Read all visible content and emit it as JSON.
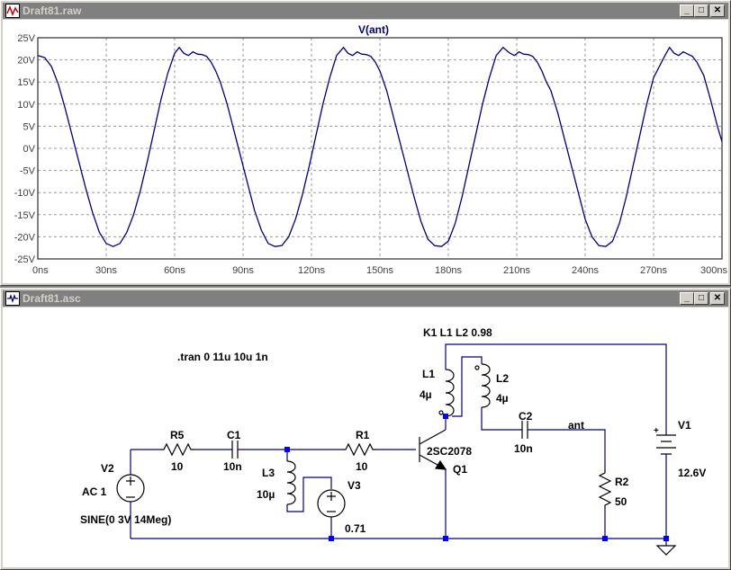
{
  "plot_window": {
    "title": "Draft81.raw",
    "trace_label": "V(ant)"
  },
  "chart_data": {
    "type": "line",
    "title": "V(ant)",
    "xlabel": "",
    "ylabel": "",
    "x_ticks": [
      "0ns",
      "30ns",
      "60ns",
      "90ns",
      "120ns",
      "150ns",
      "180ns",
      "210ns",
      "240ns",
      "270ns",
      "300ns"
    ],
    "y_ticks": [
      "25V",
      "20V",
      "15V",
      "10V",
      "5V",
      "0V",
      "-5V",
      "-10V",
      "-15V",
      "-20V",
      "-25V"
    ],
    "xlim": [
      0,
      300
    ],
    "ylim": [
      -25,
      25
    ],
    "grid": true,
    "x_unit": "ns",
    "y_unit": "V",
    "series": [
      {
        "name": "V(ant)",
        "color": "#000080",
        "x": [
          0,
          3,
          6,
          9,
          12,
          15,
          18,
          21,
          24,
          27,
          30,
          33,
          36,
          39,
          42,
          45,
          48,
          51,
          54,
          57,
          60,
          62,
          64,
          66,
          68,
          70,
          72,
          74,
          76,
          78,
          80,
          83,
          86,
          89,
          92,
          95,
          98,
          101,
          104,
          107,
          110,
          113,
          116,
          119,
          122,
          125,
          128,
          131,
          134,
          136,
          138,
          140,
          142,
          144,
          146,
          148,
          150,
          153,
          156,
          159,
          162,
          165,
          168,
          171,
          174,
          177,
          180,
          183,
          186,
          189,
          192,
          195,
          198,
          201,
          204,
          207,
          209,
          211,
          213,
          215,
          217,
          219,
          221,
          223,
          225,
          228,
          231,
          234,
          237,
          240,
          243,
          246,
          249,
          252,
          255,
          258,
          261,
          264,
          267,
          270,
          275,
          277,
          279,
          281,
          283,
          285,
          287,
          289,
          292,
          295,
          298,
          300
        ],
        "y": [
          21,
          20.5,
          18.5,
          14.5,
          9,
          3,
          -3,
          -9,
          -14.5,
          -19,
          -21.5,
          -22.2,
          -21.5,
          -19,
          -15,
          -9.5,
          -3,
          4,
          11,
          17,
          21.5,
          22.8,
          21.5,
          21,
          21.8,
          21.3,
          21.2,
          20.8,
          19.5,
          17.5,
          15,
          10,
          4,
          -2,
          -8,
          -14,
          -18.5,
          -21.5,
          -22.2,
          -22,
          -20,
          -16,
          -10.5,
          -4,
          3,
          10,
          16,
          21,
          22.8,
          21.5,
          21,
          21.8,
          21.3,
          21.2,
          20.8,
          19.5,
          17.5,
          13,
          7,
          1,
          -5,
          -11,
          -16.5,
          -20.5,
          -22,
          -22.2,
          -21,
          -17,
          -11,
          -4,
          3,
          10,
          16,
          21,
          22.8,
          21.5,
          21,
          21.8,
          21.3,
          21.2,
          20.8,
          19.5,
          17.5,
          15,
          13,
          8,
          2,
          -4,
          -10,
          -16,
          -20,
          -22,
          -22.2,
          -21,
          -17,
          -11,
          -4,
          3,
          10,
          16,
          21,
          22.8,
          21.5,
          21,
          21.8,
          21.3,
          20.8,
          19.5,
          16.5,
          11,
          5,
          1.5
        ]
      }
    ]
  },
  "schematic_window": {
    "title": "Draft81.asc"
  },
  "schematic": {
    "spice_directive": ".tran 0 11u 10u 1n",
    "coupling": "K1 L1 L2 0.98",
    "net_label_ant": "ant",
    "components": {
      "V2": {
        "ref": "V2",
        "value": "AC 1",
        "extra": "SINE(0 3V 14Meg)"
      },
      "R5": {
        "ref": "R5",
        "value": "10"
      },
      "C1": {
        "ref": "C1",
        "value": "10n"
      },
      "L3": {
        "ref": "L3",
        "value": "10µ"
      },
      "V3": {
        "ref": "V3",
        "value": "0.71"
      },
      "R1": {
        "ref": "R1",
        "value": "10"
      },
      "Q1": {
        "ref": "Q1",
        "value": "2SC2078"
      },
      "L1": {
        "ref": "L1",
        "value": "4µ"
      },
      "L2": {
        "ref": "L2",
        "value": "4µ"
      },
      "C2": {
        "ref": "C2",
        "value": "10n"
      },
      "R2": {
        "ref": "R2",
        "value": "50"
      },
      "V1": {
        "ref": "V1",
        "value": "12.6V"
      }
    }
  },
  "window_controls": {
    "minimize": "_",
    "maximize": "□",
    "close": "✕"
  },
  "colors": {
    "wire": "#000080",
    "junction": "#0000ff",
    "trace": "#000080",
    "grid": "#a0a0a0",
    "titlebar_inactive": "#808080"
  }
}
